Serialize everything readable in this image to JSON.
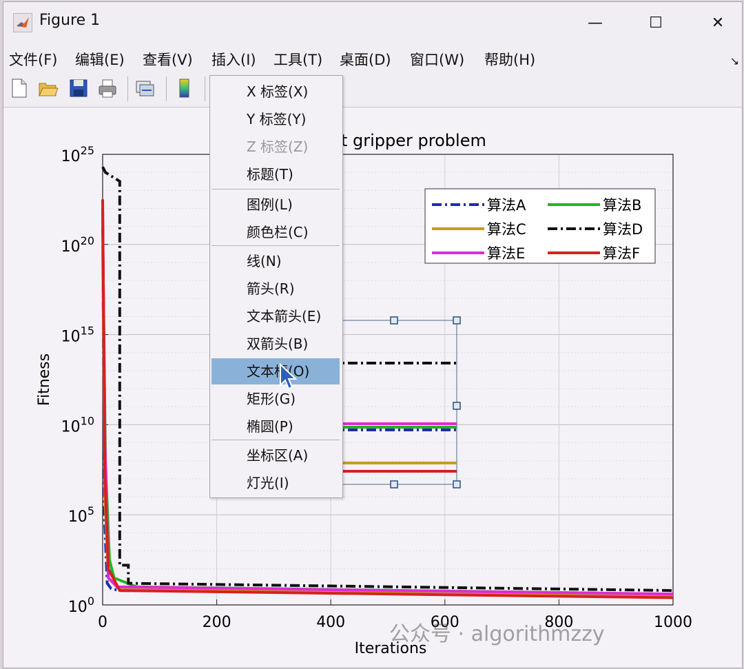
{
  "window": {
    "title": "Figure 1",
    "minimize": "—",
    "maximize": "☐",
    "close": "✕"
  },
  "menubar": {
    "items": [
      "文件(F)",
      "编辑(E)",
      "查看(V)",
      "插入(I)",
      "工具(T)",
      "桌面(D)",
      "窗口(W)",
      "帮助(H)"
    ],
    "overflow": "↘"
  },
  "toolbar": {
    "icons": [
      "new-file-icon",
      "open-folder-icon",
      "save-icon",
      "print-icon",
      "link-plot-icon",
      "colorbar-icon"
    ]
  },
  "insert_menu": {
    "items": [
      {
        "label": "X 标签(X)",
        "enabled": true
      },
      {
        "label": "Y 标签(Y)",
        "enabled": true
      },
      {
        "label": "Z 标签(Z)",
        "enabled": false
      },
      {
        "label": "标题(T)",
        "enabled": true
      },
      {
        "label": "图例(L)",
        "enabled": true
      },
      {
        "label": "颜色栏(C)",
        "enabled": true
      },
      {
        "label": "线(N)",
        "enabled": true
      },
      {
        "label": "箭头(R)",
        "enabled": true
      },
      {
        "label": "文本箭头(E)",
        "enabled": true
      },
      {
        "label": "双箭头(B)",
        "enabled": true
      },
      {
        "label": "文本框(O)",
        "enabled": true,
        "highlighted": true
      },
      {
        "label": "矩形(G)",
        "enabled": true
      },
      {
        "label": "椭圆(P)",
        "enabled": true
      },
      {
        "label": "坐标区(A)",
        "enabled": true
      },
      {
        "label": "灯光(I)",
        "enabled": true
      }
    ]
  },
  "chart_data": {
    "type": "line",
    "title": "t gripper problem",
    "xlabel": "Iterations",
    "ylabel": "Fitness",
    "xlim": [
      0,
      1000
    ],
    "yscale": "log",
    "ylim_exponent": [
      0,
      25
    ],
    "xticks": [
      "0",
      "200",
      "400",
      "600",
      "800",
      "1000"
    ],
    "yticks": [
      {
        "base": "10",
        "exp": "0"
      },
      {
        "base": "10",
        "exp": "5"
      },
      {
        "base": "10",
        "exp": "10"
      },
      {
        "base": "10",
        "exp": "15"
      },
      {
        "base": "10",
        "exp": "20"
      },
      {
        "base": "10",
        "exp": "25"
      }
    ],
    "grid": true,
    "legend_position": "top-right",
    "series": [
      {
        "name": "算法A",
        "color": "#1f2bb0",
        "style": "dashdot",
        "points": [
          [
            0,
            22
          ],
          [
            3,
            5
          ],
          [
            8,
            1.2
          ],
          [
            15,
            0.9
          ],
          [
            30,
            0.8
          ],
          [
            1000,
            0.55
          ]
        ]
      },
      {
        "name": "算法B",
        "color": "#22b322",
        "style": "solid",
        "points": [
          [
            0,
            21
          ],
          [
            5,
            8
          ],
          [
            12,
            2.5
          ],
          [
            20,
            1.5
          ],
          [
            60,
            1.0
          ],
          [
            1000,
            0.6
          ]
        ]
      },
      {
        "name": "算法C",
        "color": "#c89a1f",
        "style": "solid",
        "points": [
          [
            0,
            20
          ],
          [
            4,
            6
          ],
          [
            10,
            1.5
          ],
          [
            30,
            0.9
          ],
          [
            1000,
            0.5
          ]
        ]
      },
      {
        "name": "算法D",
        "color": "#111111",
        "style": "dashdot",
        "points": [
          [
            0,
            24.3
          ],
          [
            5,
            24
          ],
          [
            15,
            23.8
          ],
          [
            30,
            23.5
          ],
          [
            30,
            2.2
          ],
          [
            45,
            2.2
          ],
          [
            45,
            1.2
          ],
          [
            1000,
            0.8
          ]
        ]
      },
      {
        "name": "算法E",
        "color": "#e02ad8",
        "style": "solid",
        "points": [
          [
            0,
            22
          ],
          [
            4,
            9
          ],
          [
            10,
            1.5
          ],
          [
            25,
            1.0
          ],
          [
            1000,
            0.6
          ]
        ]
      },
      {
        "name": "算法F",
        "color": "#d62020",
        "style": "solid",
        "points": [
          [
            0,
            22.5
          ],
          [
            4,
            7
          ],
          [
            10,
            2
          ],
          [
            30,
            0.8
          ],
          [
            1000,
            0.4
          ]
        ]
      }
    ]
  },
  "watermark": {
    "text": "公众号 · algorithmzzy"
  }
}
